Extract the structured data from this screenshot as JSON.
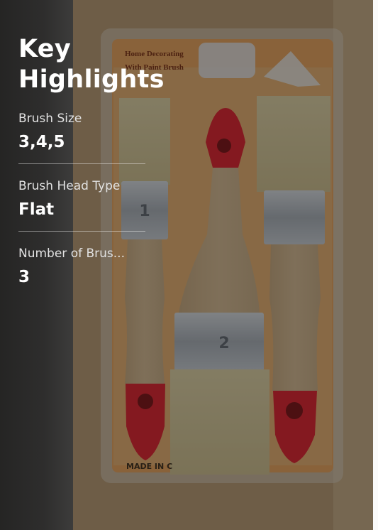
{
  "key_highlights": {
    "title": "Key Highlights",
    "items": [
      {
        "label": "Brush Size",
        "value": "3,4,5"
      },
      {
        "label": "Brush Head Type",
        "value": "Flat"
      },
      {
        "label": "Number of Brus...",
        "value": "3"
      }
    ]
  },
  "product_image": {
    "alt": "Set of three paint brushes in blister pack",
    "package_text_line1": "Home Decorating",
    "package_text_line2": "With Paint Brush",
    "package_footer_text": "MADE IN C",
    "brush_ferrule_marks": [
      "1",
      "2"
    ]
  }
}
